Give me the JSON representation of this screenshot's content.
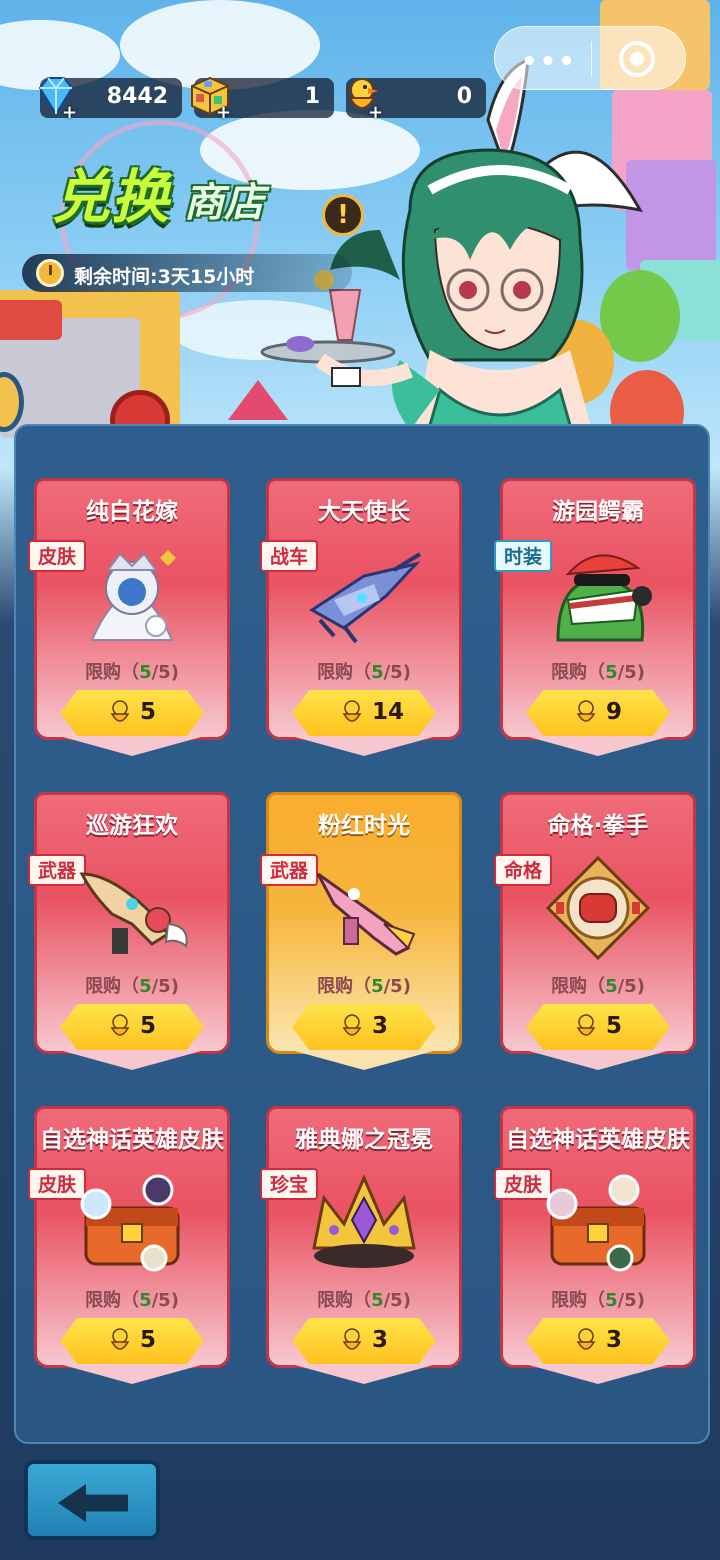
{
  "resources": [
    {
      "icon": "diamond-icon",
      "value": "8442"
    },
    {
      "icon": "rubik-cube-icon",
      "value": "1"
    },
    {
      "icon": "duck-token-icon",
      "value": "0"
    }
  ],
  "shop": {
    "title_main": "兑换",
    "title_sub": "商店",
    "info_label": "!",
    "timer_text": "剩余时间:3天15小时"
  },
  "items": [
    {
      "name": "纯白花嫁",
      "tag": "皮肤",
      "limit_prefix": "限购（",
      "limit_num": "5",
      "limit_suffix": "/5)",
      "price": "5"
    },
    {
      "name": "大天使长",
      "tag": "战车",
      "limit_prefix": "限购（",
      "limit_num": "5",
      "limit_suffix": "/5)",
      "price": "14"
    },
    {
      "name": "游园鳄霸",
      "tag": "时装",
      "limit_prefix": "限购（",
      "limit_num": "5",
      "limit_suffix": "/5)",
      "price": "9"
    },
    {
      "name": "巡游狂欢",
      "tag": "武器",
      "limit_prefix": "限购（",
      "limit_num": "5",
      "limit_suffix": "/5)",
      "price": "5"
    },
    {
      "name": "粉红时光",
      "tag": "武器",
      "limit_prefix": "限购（",
      "limit_num": "5",
      "limit_suffix": "/5)",
      "price": "3"
    },
    {
      "name": "命格·拳手",
      "tag": "命格",
      "limit_prefix": "限购（",
      "limit_num": "5",
      "limit_suffix": "/5)",
      "price": "5"
    },
    {
      "name": "自选神话英雄皮肤",
      "tag": "皮肤",
      "limit_prefix": "限购（",
      "limit_num": "5",
      "limit_suffix": "/5)",
      "price": "5"
    },
    {
      "name": "雅典娜之冠冕",
      "tag": "珍宝",
      "limit_prefix": "限购（",
      "limit_num": "5",
      "limit_suffix": "/5)",
      "price": "3"
    },
    {
      "name": "自选神话英雄皮肤",
      "tag": "皮肤",
      "limit_prefix": "限购（",
      "limit_num": "5",
      "limit_suffix": "/5)",
      "price": "3"
    }
  ],
  "colors": {
    "card_red": "#e95362",
    "card_gold": "#f6b53c",
    "price_yellow": "#ffc21f",
    "limit_green": "#2f8a2f",
    "title_green": "#c8ff3a"
  }
}
